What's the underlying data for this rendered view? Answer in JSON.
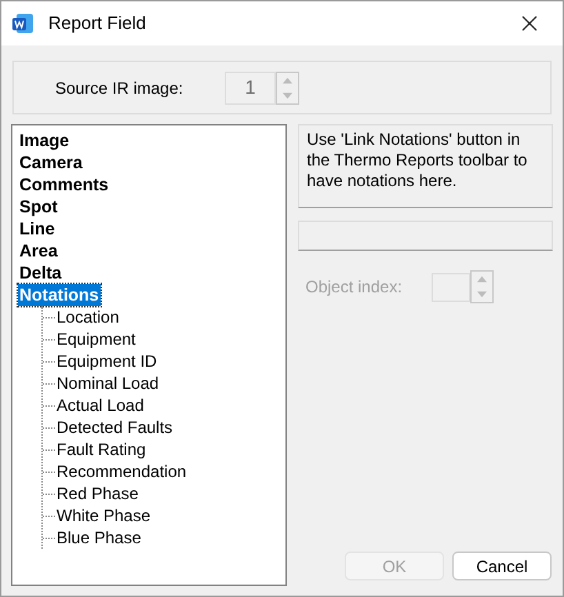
{
  "window": {
    "title": "Report Field"
  },
  "source_ir_image": {
    "label": "Source IR image:",
    "value": "1",
    "disabled": true
  },
  "tree": [
    {
      "label": "Image",
      "selected": false
    },
    {
      "label": "Camera",
      "selected": false
    },
    {
      "label": "Comments",
      "selected": false
    },
    {
      "label": "Spot",
      "selected": false
    },
    {
      "label": "Line",
      "selected": false
    },
    {
      "label": "Area",
      "selected": false
    },
    {
      "label": "Delta",
      "selected": false
    },
    {
      "label": "Notations",
      "selected": true,
      "children": [
        {
          "label": "Location",
          "selected": false
        },
        {
          "label": "Equipment",
          "selected": false
        },
        {
          "label": "Equipment ID",
          "selected": false
        },
        {
          "label": "Nominal Load",
          "selected": false
        },
        {
          "label": "Actual Load",
          "selected": false
        },
        {
          "label": "Detected Faults",
          "selected": false
        },
        {
          "label": "Fault Rating",
          "selected": false
        },
        {
          "label": "Recommendation",
          "selected": false
        },
        {
          "label": "Red Phase",
          "selected": false
        },
        {
          "label": "White Phase",
          "selected": false
        },
        {
          "label": "Blue Phase",
          "selected": false
        }
      ]
    }
  ],
  "info_text": "Use 'Link Notations' button in the Thermo Reports toolbar to have notations here.",
  "object_index": {
    "label": "Object index:",
    "disabled": true
  },
  "buttons": [
    {
      "label": "OK",
      "disabled": true
    },
    {
      "label": "Cancel",
      "disabled": false
    }
  ]
}
